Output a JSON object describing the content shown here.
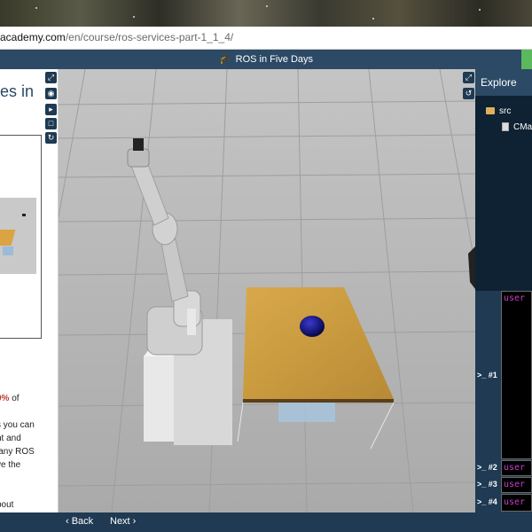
{
  "browser": {
    "url_host": "academy.com",
    "url_path": "/en/course/ros-services-part-1_1_4/"
  },
  "header": {
    "course_title": "ROS in Five Days",
    "cap_icon": "graduation-cap-icon"
  },
  "notebook": {
    "title_fragment": "es in",
    "body_lines": [
      {
        "text": "0%",
        "suffix": " of"
      },
      {
        "text": "s you can"
      },
      {
        "text": "nt and"
      },
      {
        "text": "lany ROS"
      },
      {
        "text": "ve the"
      },
      {
        "text": "bout"
      }
    ],
    "tool_icons": [
      "fullscreen-icon",
      "eye-slash-icon",
      "skip-forward-icon",
      "square-icon",
      "refresh-icon"
    ]
  },
  "viewport": {
    "tool_icons": [
      "fullscreen-icon",
      "reset-view-icon"
    ],
    "background_color": "#b5b5b5",
    "table_color": "#c9963a",
    "ball_color": "#1a1a8c"
  },
  "explorer": {
    "title": "Explore",
    "items": [
      {
        "label": "src",
        "icon": "folder-icon"
      },
      {
        "label": "CMa",
        "icon": "file-icon"
      }
    ]
  },
  "terminals": [
    {
      "label": ">_ #1",
      "prompt": "user"
    },
    {
      "label": ">_ #2",
      "prompt": "user"
    },
    {
      "label": ">_ #3",
      "prompt": "user"
    },
    {
      "label": ">_ #4",
      "prompt": "user"
    }
  ],
  "footer": {
    "back_label": "‹ Back",
    "next_label": "Next ›"
  }
}
